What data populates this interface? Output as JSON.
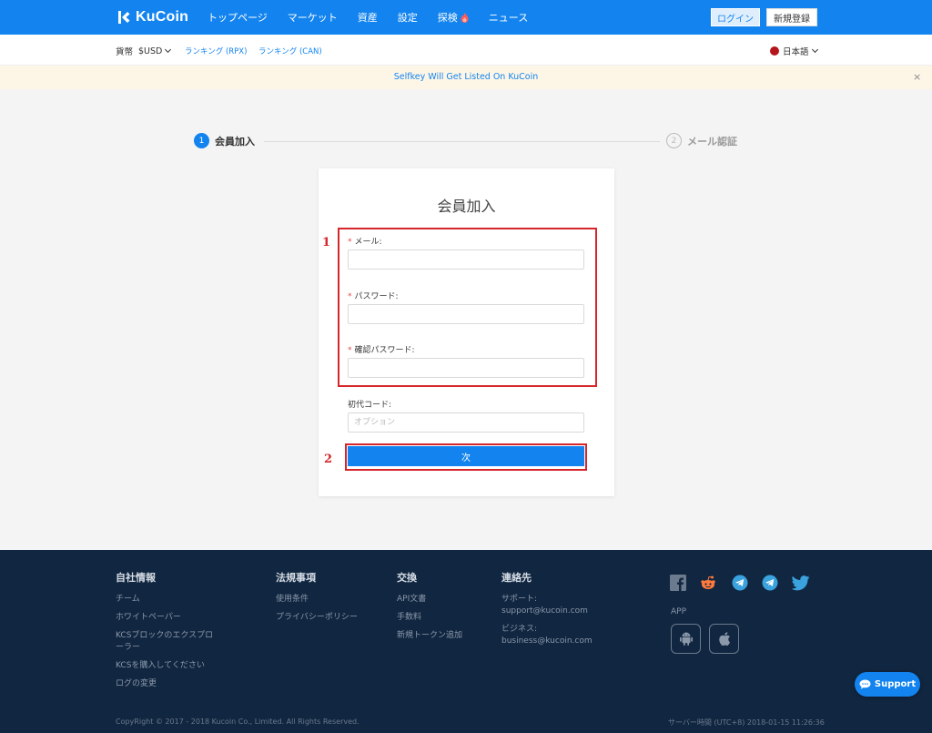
{
  "nav": {
    "logo": "KuCoin",
    "items": [
      "トップページ",
      "マーケット",
      "資産",
      "設定",
      "探検",
      "ニュース"
    ],
    "login_label": "ログイン",
    "signup_label": "新規登録"
  },
  "subbar": {
    "currency_label": "貨幣",
    "currency_value": "$USD",
    "rank_rpx": "ランキング (RPX)",
    "rank_can": "ランキング (CAN)",
    "language": "日本語"
  },
  "announcement": {
    "text": "Selfkey Will Get Listed On KuCoin",
    "close": "×"
  },
  "steps": [
    {
      "num": "1",
      "label": "会員加入"
    },
    {
      "num": "2",
      "label": "メール認証"
    }
  ],
  "form": {
    "title": "会員加入",
    "email_label": "メール:",
    "password_label": "パスワード:",
    "confirm_label": "確認パスワード:",
    "invite_label": "初代コード:",
    "invite_placeholder": "オプション",
    "required_mark": "*",
    "next_label": "次"
  },
  "annotations": [
    "1",
    "2"
  ],
  "footer": {
    "cols": [
      {
        "head": "自社情報",
        "links": [
          "チーム",
          "ホワイトペーパー",
          "KCSブロックのエクスプローラー",
          "KCSを購入してください",
          "ログの変更"
        ]
      },
      {
        "head": "法規事項",
        "links": [
          "使用条件",
          "プライバシーポリシー"
        ]
      },
      {
        "head": "交換",
        "links": [
          "API文書",
          "手数料",
          "新規トークン追加"
        ]
      },
      {
        "head": "連絡先",
        "links": [
          "サポート:",
          "support@kucoin.com",
          "ビジネス:",
          "business@kucoin.com"
        ]
      }
    ],
    "app_label": "APP",
    "copyright": "CopyRight © 2017 - 2018 Kucoin Co., Limited. All Rights Reserved.",
    "server_time": "サーバー時間 (UTC+8) 2018-01-15 11:26:36",
    "support_label": "Support"
  },
  "colors": {
    "primary": "#1384ef",
    "footer_bg": "#112640",
    "annotation": "#d7262b"
  }
}
